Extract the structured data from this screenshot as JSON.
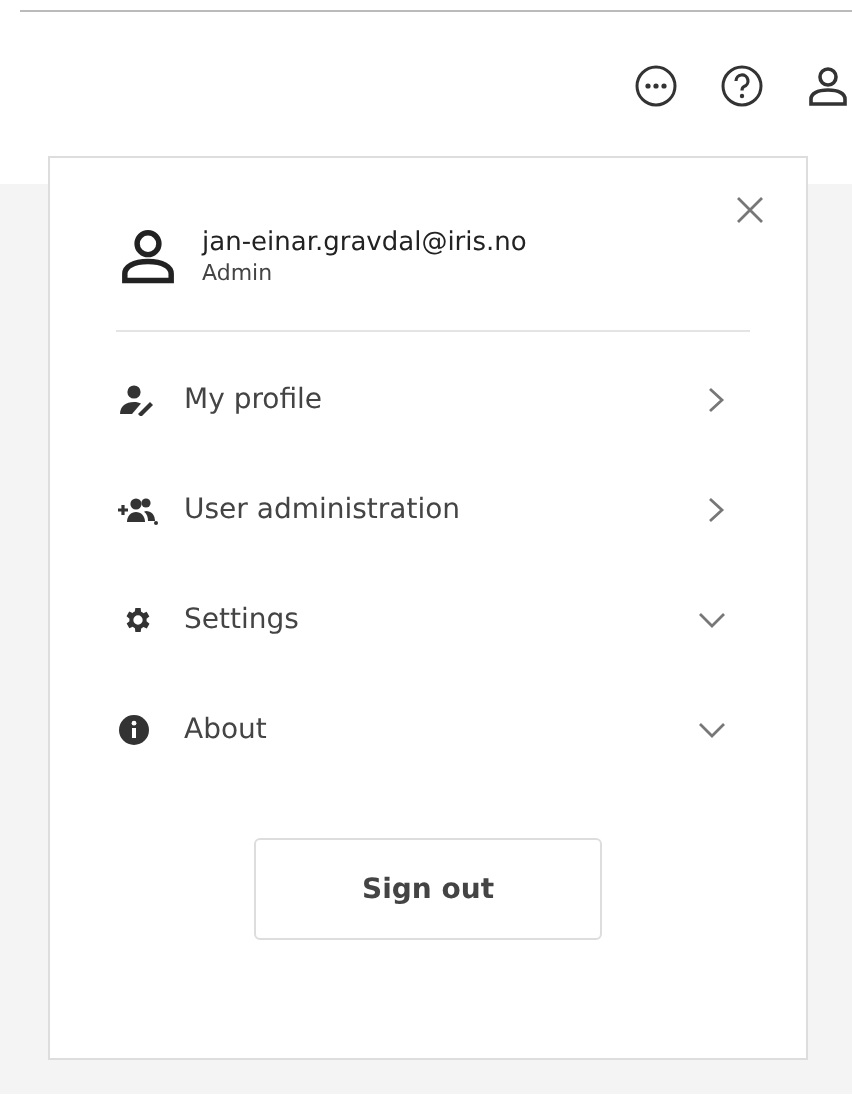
{
  "account": {
    "email": "jan-einar.gravdal@iris.no",
    "role": "Admin"
  },
  "menu": [
    {
      "label": "My profile",
      "kind": "link"
    },
    {
      "label": "User administration",
      "kind": "link"
    },
    {
      "label": "Settings",
      "kind": "section",
      "expanded": false
    },
    {
      "label": "About",
      "kind": "section",
      "expanded": false
    }
  ],
  "sign_out": "Sign out"
}
